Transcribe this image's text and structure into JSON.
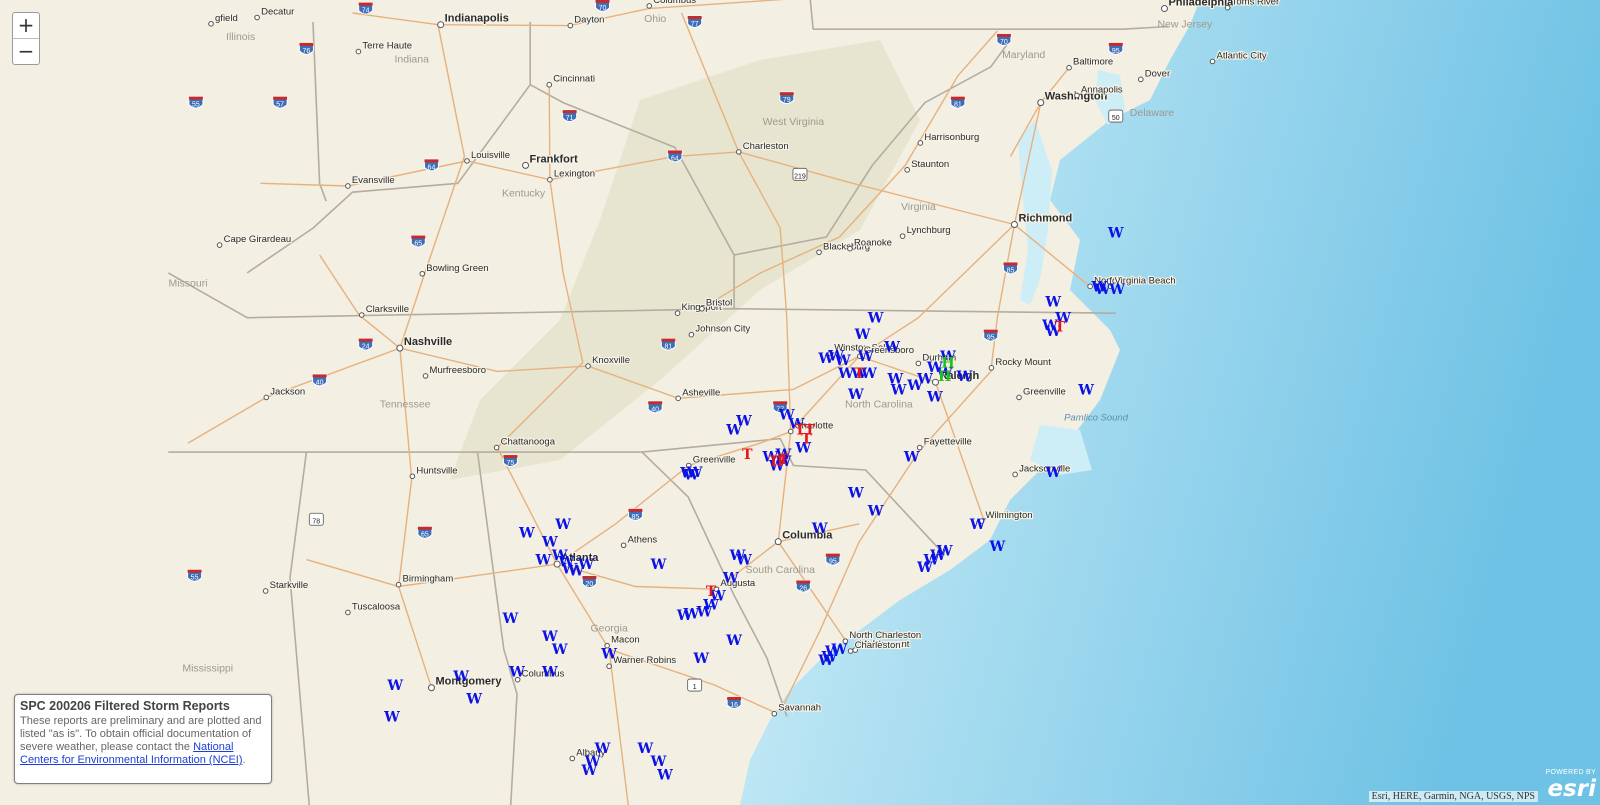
{
  "controls": {
    "zoom_in": "+",
    "zoom_out": "−"
  },
  "legend": {
    "title": "SPC 200206 Filtered Storm Reports",
    "body": "These reports are preliminary and are plotted and listed \"as is\". To obtain official documentation of severe weather, please contact the ",
    "link_text": "National Centers for Environmental Information (NCEI)",
    "end": "."
  },
  "attribution": "Esri, HERE, Garmin, NGA, USGS, NPS",
  "powered_by": {
    "top": "POWERED BY",
    "brand": "esri"
  },
  "colors": {
    "wind": "#0a12e6",
    "tornado": "#e8151c",
    "hail": "#21c21c",
    "ocean_near": "#c9ecf5",
    "ocean_far": "#62bde2",
    "land": "#f3efe2"
  },
  "cities": [
    {
      "name": "Philadelphia",
      "lon": -75.16,
      "lat": 39.95,
      "cap": 1
    },
    {
      "name": "Toms River",
      "lon": -74.2,
      "lat": 39.96
    },
    {
      "name": "Columbus",
      "lon": -82.99,
      "lat": 39.98
    },
    {
      "name": "Decatur",
      "lon": -88.95,
      "lat": 39.85
    },
    {
      "name": "gfield",
      "lon": -89.65,
      "lat": 39.78
    },
    {
      "name": "Indianapolis",
      "lon": -86.16,
      "lat": 39.77,
      "cap": 1
    },
    {
      "name": "Dayton",
      "lon": -84.19,
      "lat": 39.76
    },
    {
      "name": "Baltimore",
      "lon": -76.61,
      "lat": 39.29
    },
    {
      "name": "Atlantic City",
      "lon": -74.43,
      "lat": 39.36
    },
    {
      "name": "Terre Haute",
      "lon": -87.41,
      "lat": 39.47
    },
    {
      "name": "Cincinnati",
      "lon": -84.51,
      "lat": 39.1
    },
    {
      "name": "Dover",
      "lon": -75.52,
      "lat": 39.16
    },
    {
      "name": "Washington",
      "lon": -77.04,
      "lat": 38.9,
      "cap": 1
    },
    {
      "name": "Annapolis",
      "lon": -76.49,
      "lat": 38.98
    },
    {
      "name": "Charleston",
      "lon": -81.63,
      "lat": 38.35
    },
    {
      "name": "Harrisonburg",
      "lon": -78.87,
      "lat": 38.45
    },
    {
      "name": "Louisville",
      "lon": -85.76,
      "lat": 38.25
    },
    {
      "name": "Frankfort",
      "lon": -84.87,
      "lat": 38.2,
      "cap": 1
    },
    {
      "name": "Lexington",
      "lon": -84.5,
      "lat": 38.04
    },
    {
      "name": "Staunton",
      "lon": -79.07,
      "lat": 38.15
    },
    {
      "name": "Evansville",
      "lon": -87.57,
      "lat": 37.97
    },
    {
      "name": "Richmond",
      "lon": -77.44,
      "lat": 37.54,
      "cap": 1
    },
    {
      "name": "Lynchburg",
      "lon": -79.14,
      "lat": 37.41
    },
    {
      "name": "Cape Girardeau",
      "lon": -89.52,
      "lat": 37.31
    },
    {
      "name": "Blacksburg",
      "lon": -80.41,
      "lat": 37.23
    },
    {
      "name": "Roanoke",
      "lon": -79.94,
      "lat": 37.27
    },
    {
      "name": "Bowling Green",
      "lon": -86.44,
      "lat": 36.99
    },
    {
      "name": "Norfolk",
      "lon": -76.29,
      "lat": 36.85
    },
    {
      "name": "Virginia Beach",
      "lon": -75.98,
      "lat": 36.85
    },
    {
      "name": "Clarksville",
      "lon": -87.36,
      "lat": 36.53
    },
    {
      "name": "Kingsport",
      "lon": -82.56,
      "lat": 36.55
    },
    {
      "name": "Bristol",
      "lon": -82.19,
      "lat": 36.6
    },
    {
      "name": "Johnson City",
      "lon": -82.35,
      "lat": 36.31
    },
    {
      "name": "Nashville",
      "lon": -86.78,
      "lat": 36.16,
      "cap": 1
    },
    {
      "name": "Winston-Salem",
      "lon": -80.24,
      "lat": 36.1
    },
    {
      "name": "Greensboro",
      "lon": -79.79,
      "lat": 36.07
    },
    {
      "name": "Durham",
      "lon": -78.9,
      "lat": 35.99
    },
    {
      "name": "Rocky Mount",
      "lon": -77.79,
      "lat": 35.94
    },
    {
      "name": "Murfreesboro",
      "lon": -86.39,
      "lat": 35.85
    },
    {
      "name": "Knoxville",
      "lon": -83.92,
      "lat": 35.96
    },
    {
      "name": "Raleigh",
      "lon": -78.64,
      "lat": 35.78,
      "cap": 1
    },
    {
      "name": "Asheville",
      "lon": -82.55,
      "lat": 35.6
    },
    {
      "name": "Jackson",
      "lon": -88.81,
      "lat": 35.61
    },
    {
      "name": "Greenville",
      "lon": -77.37,
      "lat": 35.61
    },
    {
      "name": "Charlotte",
      "lon": -80.84,
      "lat": 35.23
    },
    {
      "name": "Chattanooga",
      "lon": -85.31,
      "lat": 35.05
    },
    {
      "name": "Fayetteville",
      "lon": -78.88,
      "lat": 35.05
    },
    {
      "name": "Huntsville",
      "lon": -86.59,
      "lat": 34.73
    },
    {
      "name": "Greenville",
      "lon": -82.39,
      "lat": 34.85
    },
    {
      "name": "Jacksonville",
      "lon": -77.43,
      "lat": 34.75
    },
    {
      "name": "Wilmington",
      "lon": -77.94,
      "lat": 34.23
    },
    {
      "name": "Athens",
      "lon": -83.38,
      "lat": 33.96
    },
    {
      "name": "Columbia",
      "lon": -81.03,
      "lat": 34.0,
      "cap": 1
    },
    {
      "name": "Atlanta",
      "lon": -84.39,
      "lat": 33.75,
      "cap": 1
    },
    {
      "name": "Birmingham",
      "lon": -86.8,
      "lat": 33.52
    },
    {
      "name": "Starkville",
      "lon": -88.82,
      "lat": 33.45
    },
    {
      "name": "Augusta",
      "lon": -81.97,
      "lat": 33.47
    },
    {
      "name": "Tuscaloosa",
      "lon": -87.57,
      "lat": 33.21
    },
    {
      "name": "Macon",
      "lon": -83.63,
      "lat": 32.84
    },
    {
      "name": "North Charleston",
      "lon": -80.01,
      "lat": 32.89
    },
    {
      "name": "Mt Pleasant",
      "lon": -79.86,
      "lat": 32.79
    },
    {
      "name": "Charleston",
      "lon": -79.93,
      "lat": 32.78
    },
    {
      "name": "Warner Robins",
      "lon": -83.6,
      "lat": 32.61
    },
    {
      "name": "Montgomery",
      "lon": -86.3,
      "lat": 32.37,
      "cap": 1
    },
    {
      "name": "Columbus",
      "lon": -84.99,
      "lat": 32.46
    },
    {
      "name": "Savannah",
      "lon": -81.09,
      "lat": 32.08
    },
    {
      "name": "Albany",
      "lon": -84.16,
      "lat": 31.58
    }
  ],
  "states": [
    {
      "name": "Illinois",
      "lon": -89.2,
      "lat": 39.6
    },
    {
      "name": "Indiana",
      "lon": -86.6,
      "lat": 39.35
    },
    {
      "name": "Ohio",
      "lon": -82.9,
      "lat": 39.8
    },
    {
      "name": "New Jersey",
      "lon": -74.85,
      "lat": 39.74
    },
    {
      "name": "Maryland",
      "lon": -77.3,
      "lat": 39.4
    },
    {
      "name": "Delaware",
      "lon": -75.35,
      "lat": 38.75
    },
    {
      "name": "West Virginia",
      "lon": -80.8,
      "lat": 38.65
    },
    {
      "name": "Kentucky",
      "lon": -84.9,
      "lat": 37.85
    },
    {
      "name": "Virginia",
      "lon": -78.9,
      "lat": 37.7
    },
    {
      "name": "Missouri",
      "lon": -90.0,
      "lat": 36.85
    },
    {
      "name": "Tennessee",
      "lon": -86.7,
      "lat": 35.5
    },
    {
      "name": "North Carolina",
      "lon": -79.5,
      "lat": 35.5
    },
    {
      "name": "South Carolina",
      "lon": -81.0,
      "lat": 33.65
    },
    {
      "name": "Georgia",
      "lon": -83.6,
      "lat": 33.0
    },
    {
      "name": "Mississippi",
      "lon": -89.7,
      "lat": 32.55
    }
  ],
  "water_labels": [
    {
      "name": "Pamlico Sound",
      "lon": -76.2,
      "lat": 35.35
    }
  ],
  "shields": [
    {
      "num": "74",
      "lon": -87.3,
      "lat": 39.95,
      "t": "i"
    },
    {
      "num": "70",
      "lon": -83.7,
      "lat": 39.98,
      "t": "i"
    },
    {
      "num": "77",
      "lon": -82.3,
      "lat": 39.8,
      "t": "i"
    },
    {
      "num": "70",
      "lon": -77.6,
      "lat": 39.6,
      "t": "i"
    },
    {
      "num": "95",
      "lon": -75.9,
      "lat": 39.5,
      "t": "i"
    },
    {
      "num": "76",
      "lon": -88.2,
      "lat": 39.5,
      "t": "i"
    },
    {
      "num": "55",
      "lon": -89.88,
      "lat": 38.9,
      "t": "i"
    },
    {
      "num": "57",
      "lon": -88.6,
      "lat": 38.9,
      "t": "i"
    },
    {
      "num": "71",
      "lon": -84.2,
      "lat": 38.75,
      "t": "i"
    },
    {
      "num": "79",
      "lon": -80.9,
      "lat": 38.95,
      "t": "i"
    },
    {
      "num": "81",
      "lon": -78.3,
      "lat": 38.9,
      "t": "i"
    },
    {
      "num": "50",
      "lon": -75.9,
      "lat": 38.75,
      "t": "u"
    },
    {
      "num": "64",
      "lon": -86.3,
      "lat": 38.2,
      "t": "i"
    },
    {
      "num": "64",
      "lon": -82.6,
      "lat": 38.3,
      "t": "i"
    },
    {
      "num": "219",
      "lon": -80.7,
      "lat": 38.1,
      "t": "u"
    },
    {
      "num": "65",
      "lon": -86.5,
      "lat": 37.35,
      "t": "i"
    },
    {
      "num": "85",
      "lon": -77.5,
      "lat": 37.05,
      "t": "i"
    },
    {
      "num": "24",
      "lon": -87.3,
      "lat": 36.2,
      "t": "i"
    },
    {
      "num": "81",
      "lon": -82.7,
      "lat": 36.2,
      "t": "i"
    },
    {
      "num": "95",
      "lon": -77.8,
      "lat": 36.3,
      "t": "i"
    },
    {
      "num": "40",
      "lon": -88.0,
      "lat": 35.8,
      "t": "i"
    },
    {
      "num": "40",
      "lon": -82.9,
      "lat": 35.5,
      "t": "i"
    },
    {
      "num": "77",
      "lon": -81.0,
      "lat": 35.5,
      "t": "i"
    },
    {
      "num": "75",
      "lon": -85.1,
      "lat": 34.9,
      "t": "i"
    },
    {
      "num": "78",
      "lon": -88.05,
      "lat": 34.25,
      "t": "u"
    },
    {
      "num": "65",
      "lon": -86.4,
      "lat": 34.1,
      "t": "i"
    },
    {
      "num": "85",
      "lon": -83.2,
      "lat": 34.3,
      "t": "i"
    },
    {
      "num": "55",
      "lon": -89.9,
      "lat": 33.62,
      "t": "i"
    },
    {
      "num": "20",
      "lon": -83.9,
      "lat": 33.55,
      "t": "i"
    },
    {
      "num": "95",
      "lon": -80.2,
      "lat": 33.8,
      "t": "i"
    },
    {
      "num": "26",
      "lon": -80.65,
      "lat": 33.5,
      "t": "i"
    },
    {
      "num": "1",
      "lon": -82.3,
      "lat": 32.4,
      "t": "u"
    },
    {
      "num": "16",
      "lon": -81.7,
      "lat": 32.2,
      "t": "i"
    }
  ],
  "reports": {
    "wind": [
      [
        -75.9,
        37.45
      ],
      [
        -76.15,
        36.85
      ],
      [
        -76.1,
        36.82
      ],
      [
        -75.88,
        36.82
      ],
      [
        -76.85,
        36.68
      ],
      [
        -76.7,
        36.5
      ],
      [
        -76.85,
        36.35
      ],
      [
        -76.9,
        36.42
      ],
      [
        -76.35,
        35.7
      ],
      [
        -76.85,
        34.78
      ],
      [
        -78.45,
        36.07
      ],
      [
        -78.65,
        35.95
      ],
      [
        -78.5,
        35.88
      ],
      [
        -78.8,
        35.82
      ],
      [
        -78.2,
        35.85
      ],
      [
        -78.65,
        35.62
      ],
      [
        -79.55,
        36.5
      ],
      [
        -79.75,
        36.32
      ],
      [
        -79.3,
        36.18
      ],
      [
        -79.7,
        36.07
      ],
      [
        -80.3,
        36.05
      ],
      [
        -80.05,
        36.03
      ],
      [
        -80.15,
        36.08
      ],
      [
        -80.0,
        35.88
      ],
      [
        -79.8,
        35.88
      ],
      [
        -79.65,
        35.88
      ],
      [
        -79.25,
        35.82
      ],
      [
        -79.2,
        35.7
      ],
      [
        -78.95,
        35.75
      ],
      [
        -79.85,
        35.65
      ],
      [
        -80.9,
        35.42
      ],
      [
        -80.75,
        35.32
      ],
      [
        -80.65,
        35.05
      ],
      [
        -81.55,
        35.35
      ],
      [
        -81.7,
        35.25
      ],
      [
        -80.95,
        34.98
      ],
      [
        -80.95,
        34.9
      ],
      [
        -81.05,
        34.85
      ],
      [
        -81.15,
        34.95
      ],
      [
        -79.0,
        34.95
      ],
      [
        -79.85,
        34.55
      ],
      [
        -79.55,
        34.35
      ],
      [
        -80.4,
        34.15
      ],
      [
        -82.3,
        34.78
      ],
      [
        -82.35,
        34.75
      ],
      [
        -82.4,
        34.77
      ],
      [
        -78.0,
        34.2
      ],
      [
        -77.7,
        33.95
      ],
      [
        -78.5,
        33.9
      ],
      [
        -78.6,
        33.85
      ],
      [
        -78.7,
        33.8
      ],
      [
        -78.8,
        33.72
      ],
      [
        -81.65,
        33.85
      ],
      [
        -81.55,
        33.8
      ],
      [
        -81.75,
        33.6
      ],
      [
        -82.85,
        33.75
      ],
      [
        -81.95,
        33.4
      ],
      [
        -82.05,
        33.3
      ],
      [
        -82.15,
        33.22
      ],
      [
        -82.35,
        33.2
      ],
      [
        -82.45,
        33.18
      ],
      [
        -81.7,
        32.9
      ],
      [
        -82.2,
        32.7
      ],
      [
        -80.1,
        32.8
      ],
      [
        -80.2,
        32.78
      ],
      [
        -80.25,
        32.72
      ],
      [
        -80.3,
        32.68
      ],
      [
        -84.85,
        34.1
      ],
      [
        -84.3,
        34.2
      ],
      [
        -84.5,
        34.0
      ],
      [
        -84.35,
        33.85
      ],
      [
        -84.6,
        33.8
      ],
      [
        -84.25,
        33.78
      ],
      [
        -84.2,
        33.7
      ],
      [
        -84.1,
        33.68
      ],
      [
        -83.95,
        33.75
      ],
      [
        -85.1,
        33.15
      ],
      [
        -84.5,
        32.95
      ],
      [
        -84.35,
        32.8
      ],
      [
        -85.0,
        32.55
      ],
      [
        -84.5,
        32.55
      ],
      [
        -83.6,
        32.75
      ],
      [
        -85.85,
        32.5
      ],
      [
        -85.65,
        32.25
      ],
      [
        -86.85,
        32.4
      ],
      [
        -86.9,
        32.05
      ],
      [
        -83.7,
        31.7
      ],
      [
        -83.05,
        31.7
      ],
      [
        -83.85,
        31.55
      ],
      [
        -83.9,
        31.45
      ],
      [
        -82.85,
        31.55
      ],
      [
        -82.75,
        31.4
      ]
    ],
    "tornado": [
      [
        -76.75,
        36.4
      ],
      [
        -80.7,
        35.25
      ],
      [
        -80.55,
        35.25
      ],
      [
        -80.6,
        35.15
      ],
      [
        -81.5,
        34.98
      ],
      [
        -81.0,
        34.9
      ],
      [
        -81.1,
        34.9
      ],
      [
        -80.95,
        34.92
      ],
      [
        -82.05,
        33.45
      ],
      [
        -79.8,
        35.88
      ]
    ],
    "hail": [
      [
        -78.45,
        36.0
      ],
      [
        -78.5,
        35.85
      ]
    ]
  }
}
